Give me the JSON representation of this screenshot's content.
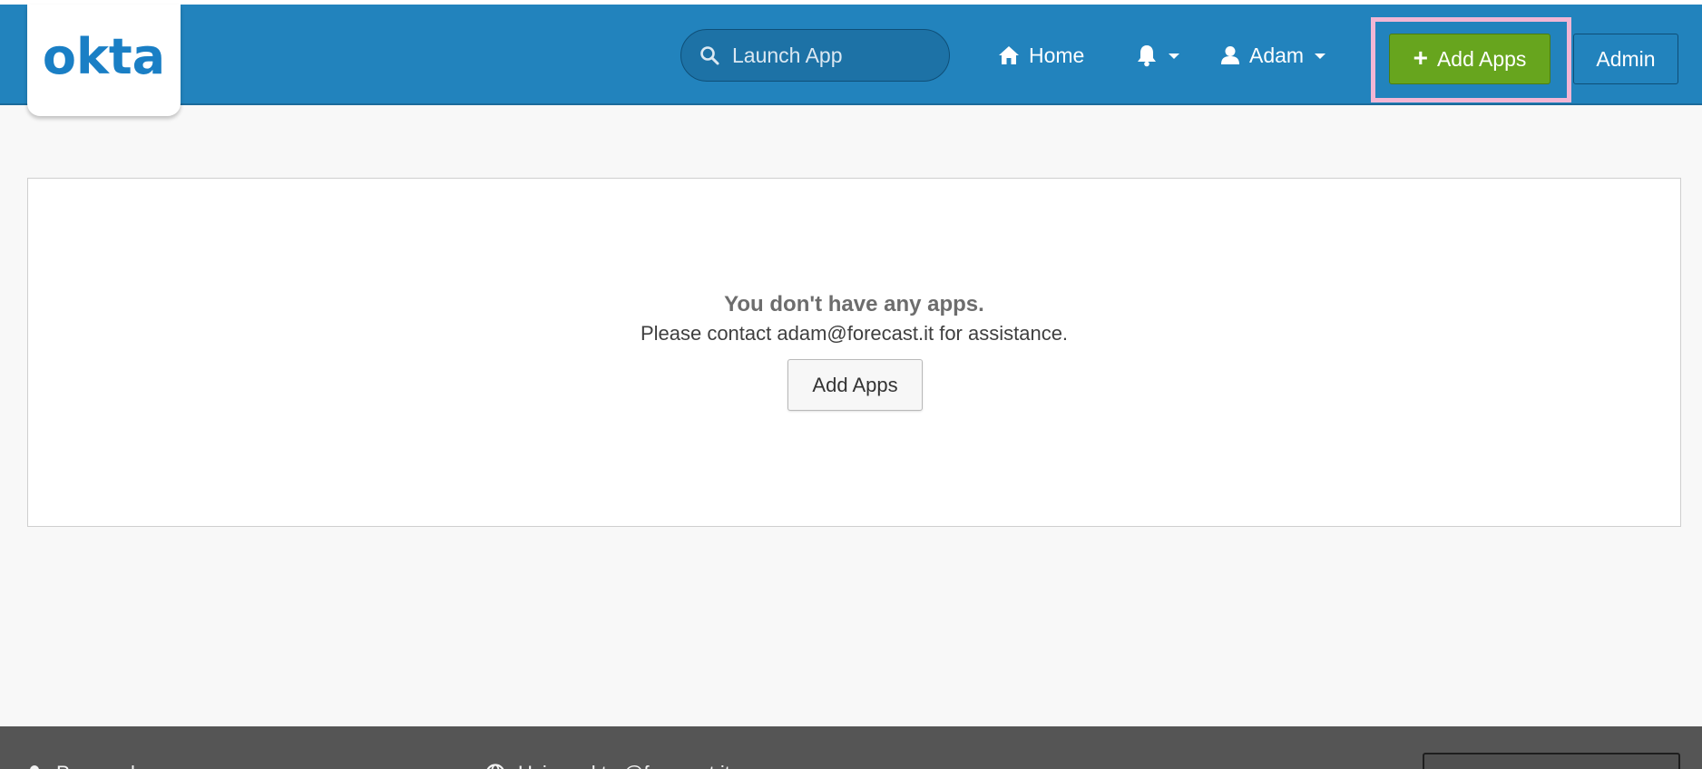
{
  "header": {
    "logo_text": "okta",
    "search_placeholder": "Launch App",
    "home_label": "Home",
    "user_label": "Adam",
    "add_apps_label": "Add Apps",
    "admin_label": "Admin",
    "brand_color": "#2283bd",
    "add_apps_color": "#67a51e",
    "highlight_color": "#f2b6d4"
  },
  "main": {
    "empty_title": "You don't have any apps.",
    "empty_message": "Please contact adam@forecast.it for assistance.",
    "add_apps_button": "Add Apps"
  },
  "footer": {
    "item_1": "Personal",
    "item_2": "Using .okta.@forecast.it"
  }
}
